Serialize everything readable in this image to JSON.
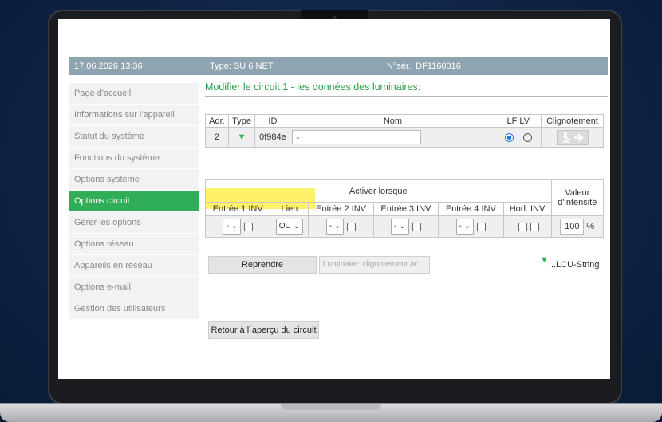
{
  "header": {
    "datetime": "17.06.2026 13:36",
    "type": "Type: SU 6 NET",
    "serial": "N°sér.: DF1160016"
  },
  "sidebar": {
    "items": [
      {
        "label": "Page d'accueil",
        "active": false
      },
      {
        "label": "Informations sur l'appareil",
        "active": false
      },
      {
        "label": "Statut du système",
        "active": false
      },
      {
        "label": "Fonctions du système",
        "active": false
      },
      {
        "label": "Options système",
        "active": false
      },
      {
        "label": "Options circuit",
        "active": true
      },
      {
        "label": "Gérer les options",
        "active": false
      },
      {
        "label": "Options réseau",
        "active": false
      },
      {
        "label": "Appareils en réseau",
        "active": false
      },
      {
        "label": "Options e-mail",
        "active": false
      },
      {
        "label": "Gestion des utilisateurs",
        "active": false
      }
    ]
  },
  "main": {
    "title": "Modifier le circuit 1 - les données des luminaires:",
    "luminaire_table": {
      "headers": {
        "adr": "Adr.",
        "type": "Type",
        "id": "ID",
        "nom": "Nom",
        "lflv": "LF LV",
        "clignotement": "Clignotement"
      },
      "row": {
        "adr": "2",
        "id": "0f984e",
        "nom": "-"
      }
    },
    "activation_table": {
      "activer_lorsque": "Activer lorsque",
      "valeur_intensite_1": "Valeur",
      "valeur_intensite_2": "d'intensité",
      "headers": {
        "entree1": "Entrée 1 INV",
        "lien": "Lien",
        "entree2": "Entrée 2 INV",
        "entree3": "Entrée 3 INV",
        "entree4": "Entrée 4 INV",
        "horl": "Horl. INV"
      },
      "values": {
        "entree1": "-",
        "lien": "OU",
        "entree2": "-",
        "entree3": "-",
        "entree4": "-",
        "intensite": "100",
        "unit": "%"
      }
    },
    "buttons": {
      "reprendre": "Reprendre",
      "luminaire_blink": "Luminaire: clignotement ac",
      "retour": "Retour à l´aperçu du circuit"
    },
    "lcu_label": "...LCU-String"
  },
  "colors": {
    "header_bar": "#8ea4b0",
    "active_green": "#2fae57",
    "title_green": "#2e9e4a",
    "highlight": "#fff050"
  },
  "icons": {
    "luminaire": "luminaire-icon",
    "exit_sign": "exit-sign-icon",
    "dropdown": "chevron-down-icon"
  }
}
